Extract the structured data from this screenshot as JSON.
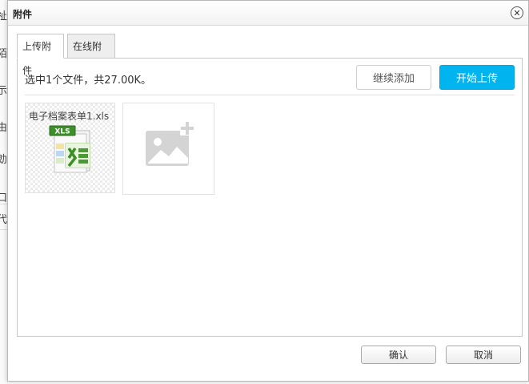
{
  "background": {
    "chars": [
      "祉",
      "陌",
      "示",
      "由",
      "勆",
      "口",
      "代"
    ]
  },
  "dialog": {
    "title": "附件",
    "close_glyph": "✕"
  },
  "tabs": [
    {
      "label": "上传附件",
      "active": true
    },
    {
      "label": "在线附件",
      "active": false
    }
  ],
  "upload": {
    "status_text": "选中1个文件，共27.00K。",
    "add_button": "继续添加",
    "upload_button": "开始上传",
    "accent_color": "#00b4ef"
  },
  "files": [
    {
      "name": "电子档案表单1.xls",
      "icon": "excel-xls-icon",
      "badge": "XLS"
    }
  ],
  "add_slot": {
    "icon": "add-image-icon"
  },
  "footer": {
    "ok_button": "确认",
    "cancel_button": "取消"
  }
}
